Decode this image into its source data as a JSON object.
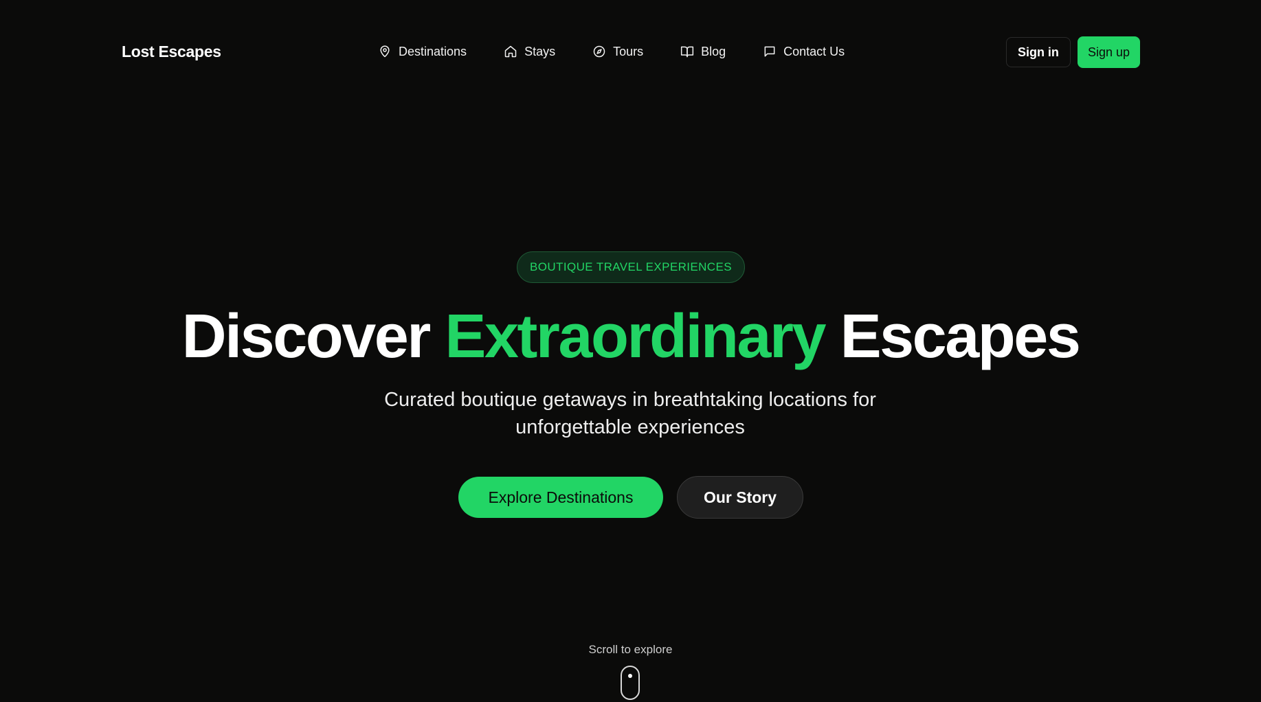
{
  "brand": {
    "name": "Lost Escapes",
    "accent_color": "#22d565",
    "background_color": "#0b0b0a"
  },
  "nav": {
    "items": [
      {
        "label": "Destinations",
        "icon": "map-pin-icon"
      },
      {
        "label": "Stays",
        "icon": "home-icon"
      },
      {
        "label": "Tours",
        "icon": "compass-icon"
      },
      {
        "label": "Blog",
        "icon": "book-open-icon"
      },
      {
        "label": "Contact Us",
        "icon": "message-square-icon"
      }
    ]
  },
  "auth": {
    "sign_in": "Sign in",
    "sign_up": "Sign up"
  },
  "hero": {
    "badge": "BOUTIQUE TRAVEL EXPERIENCES",
    "headline_part1": "Discover",
    "headline_accent": "Extraordinary",
    "headline_part2": "Escapes",
    "subtitle_line1": "Curated boutique getaways in breathtaking locations for",
    "subtitle_line2": "unforgettable experiences",
    "primary_cta": "Explore Destinations",
    "secondary_cta": "Our Story"
  },
  "scroll": {
    "hint": "Scroll to explore",
    "icon": "mouse-icon"
  }
}
